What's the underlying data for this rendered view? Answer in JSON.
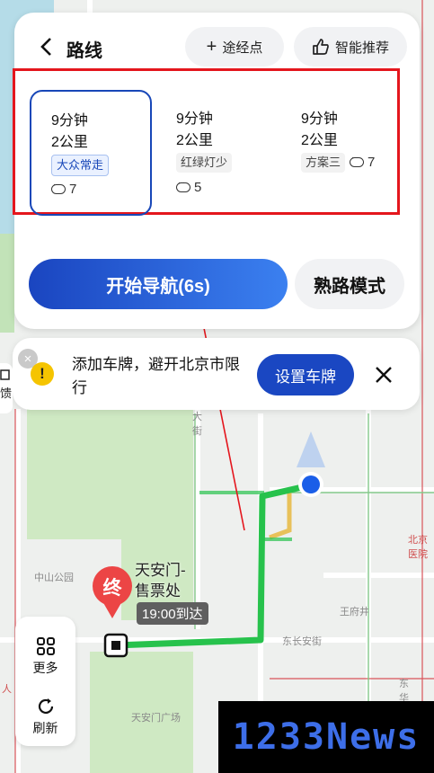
{
  "header": {
    "title": "路线",
    "waypoint_label": "途经点",
    "recommend_label": "智能推荐"
  },
  "routes": [
    {
      "time": "9分钟",
      "distance": "2公里",
      "tag": "大众常走",
      "comments": "7"
    },
    {
      "time": "9分钟",
      "distance": "2公里",
      "tag": "红绿灯少",
      "comments": "5"
    },
    {
      "time": "9分钟",
      "distance": "2公里",
      "tag": "方案三",
      "comments": "7"
    }
  ],
  "actions": {
    "start_label": "开始导航(6s)",
    "familiar_label": "熟路模式"
  },
  "tip": {
    "text": "添加车牌，避开北京市限行",
    "button": "设置车牌",
    "feedback": "馈"
  },
  "poi": {
    "marker": "终",
    "name_line1": "天安门-",
    "name_line2": "售票处",
    "eta": "19:00到达"
  },
  "tools": {
    "more": "更多",
    "refresh": "刷新"
  },
  "map_labels": {
    "street1": "大",
    "street2": "街",
    "park": "中山公园",
    "wangfujing": "王府井",
    "hospital1": "北京",
    "hospital2": "医院",
    "dongchangan": "东长安街",
    "square": "天安门广场",
    "dong": "东",
    "hua": "华",
    "ren": "人"
  },
  "watermark": "1233News",
  "colors": {
    "route": "#27c24c",
    "accent": "#1a47c2",
    "highlight": "#e4161d"
  }
}
